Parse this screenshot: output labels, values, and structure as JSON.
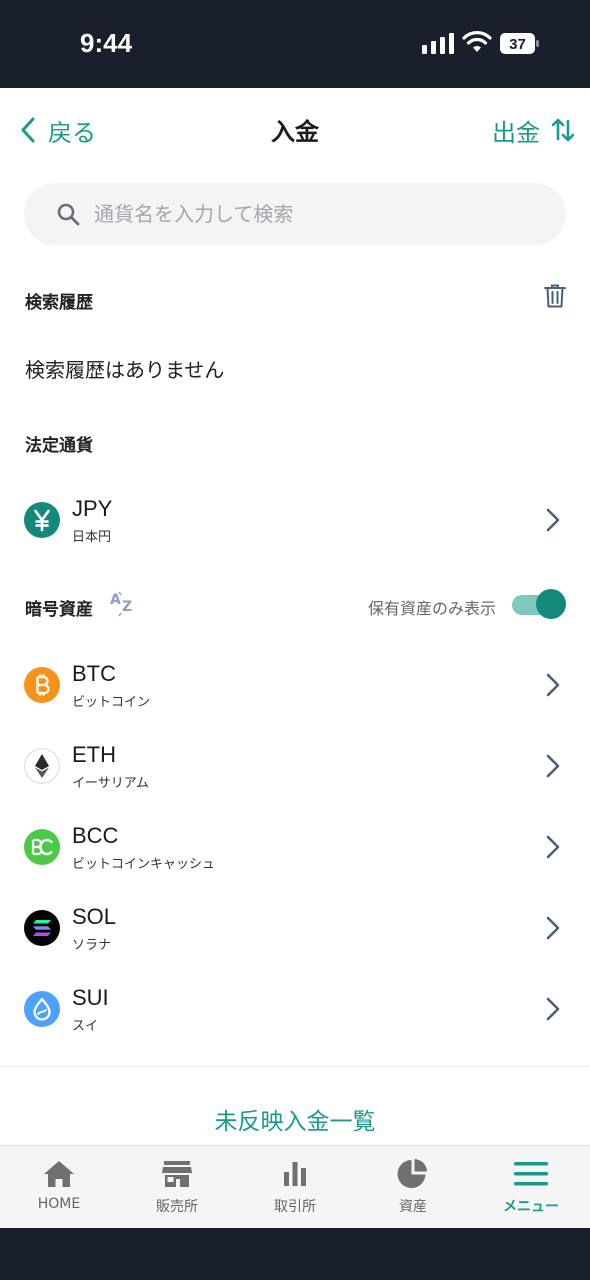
{
  "status_bar": {
    "time": "9:44",
    "battery": "37"
  },
  "nav": {
    "back_label": "戻る",
    "title": "入金",
    "withdraw_label": "出金"
  },
  "search": {
    "placeholder": "通貨名を入力して検索"
  },
  "history": {
    "title": "検索履歴",
    "empty_text": "検索履歴はありません"
  },
  "fiat": {
    "title": "法定通貨",
    "items": [
      {
        "code": "JPY",
        "name": "日本円",
        "icon": "yen-icon",
        "color": "#12897a"
      }
    ]
  },
  "crypto": {
    "title": "暗号資産",
    "toggle_label": "保有資産のみ表示",
    "toggle_on": true,
    "items": [
      {
        "code": "BTC",
        "name": "ビットコイン",
        "icon": "bitcoin-icon",
        "color": "#f7931a"
      },
      {
        "code": "ETH",
        "name": "イーサリアム",
        "icon": "ethereum-icon",
        "color": "#ffffff"
      },
      {
        "code": "BCC",
        "name": "ビットコインキャッシュ",
        "icon": "bitcoin-cash-icon",
        "color": "#4cc947"
      },
      {
        "code": "SOL",
        "name": "ソラナ",
        "icon": "solana-icon",
        "color": "#000000"
      },
      {
        "code": "SUI",
        "name": "スイ",
        "icon": "sui-icon",
        "color": "#4da2ff"
      }
    ]
  },
  "pending_link": "未反映入金一覧",
  "tabbar": {
    "tabs": [
      {
        "label": "HOME",
        "icon": "home-icon"
      },
      {
        "label": "販売所",
        "icon": "store-icon"
      },
      {
        "label": "取引所",
        "icon": "bar-chart-icon"
      },
      {
        "label": "資産",
        "icon": "pie-chart-icon"
      },
      {
        "label": "メニュー",
        "icon": "menu-icon",
        "active": true
      }
    ]
  },
  "colors": {
    "accent": "#1a9a8a",
    "chevron": "#4a5f7a",
    "status_bar": "#1a1f2c"
  }
}
